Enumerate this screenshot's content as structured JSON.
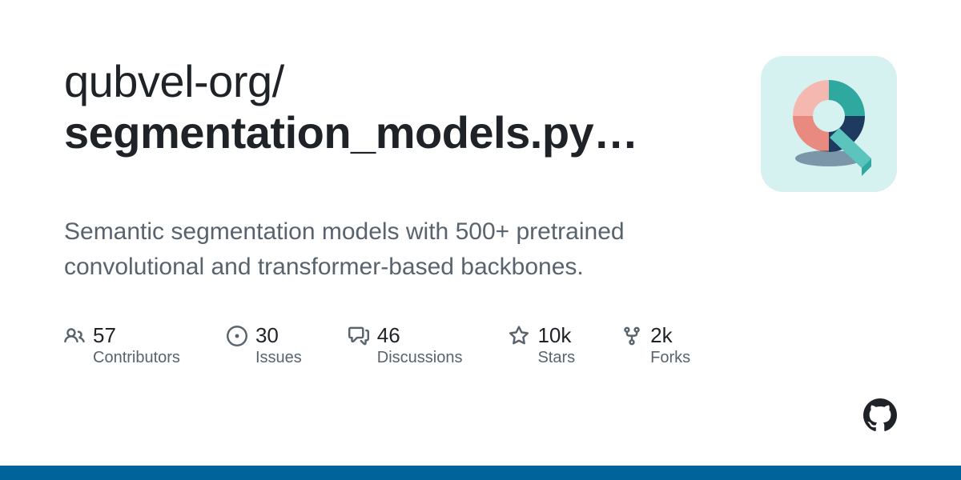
{
  "repo": {
    "owner": "qubvel-org/",
    "name": "segmentation_models.py…"
  },
  "description": "Semantic segmentation models with 500+ pretrained convolutional and transformer-based backbones.",
  "stats": {
    "contributors": {
      "value": "57",
      "label": "Contributors"
    },
    "issues": {
      "value": "30",
      "label": "Issues"
    },
    "discussions": {
      "value": "46",
      "label": "Discussions"
    },
    "stars": {
      "value": "10k",
      "label": "Stars"
    },
    "forks": {
      "value": "2k",
      "label": "Forks"
    }
  },
  "accent_color": "#006399"
}
